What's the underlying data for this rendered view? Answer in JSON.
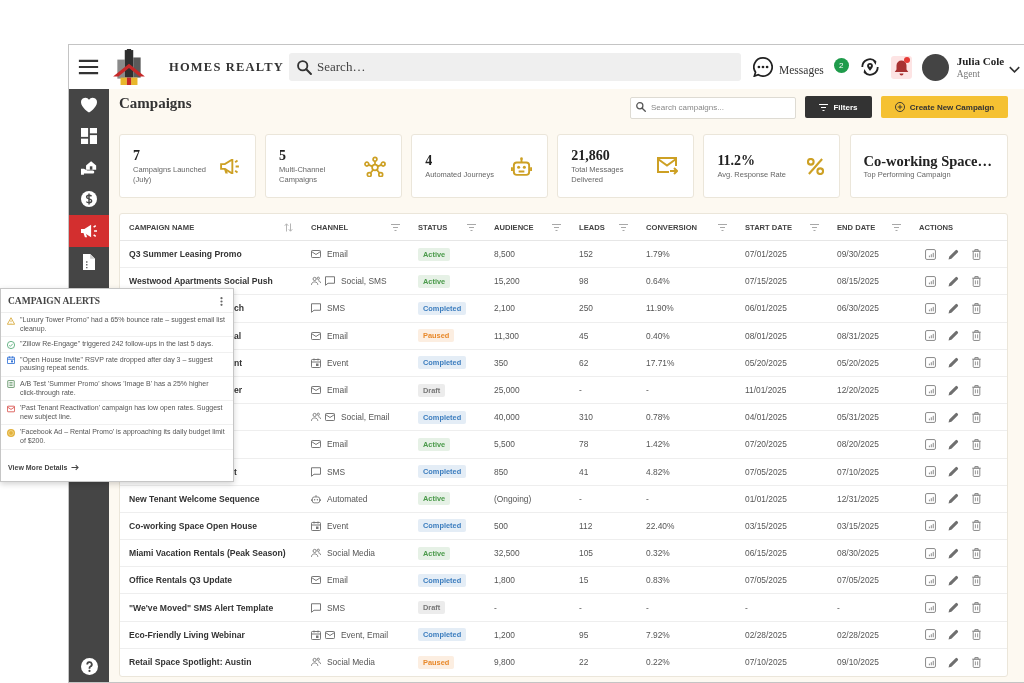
{
  "header": {
    "brand": "HOMES REALTY",
    "search": {
      "placeholder": "Search…"
    },
    "messages": {
      "label": "Messages",
      "count": "2"
    },
    "notifications": {
      "unread": true
    },
    "user": {
      "name": "Julia Cole",
      "role": "Agent"
    }
  },
  "sidebar": {
    "items": [
      {
        "kind": "favorites",
        "selected": false
      },
      {
        "kind": "dashboard",
        "selected": false
      },
      {
        "kind": "properties",
        "selected": false
      },
      {
        "kind": "finance",
        "selected": false
      },
      {
        "kind": "campaigns",
        "selected": true
      },
      {
        "kind": "documents",
        "selected": false
      }
    ]
  },
  "page": {
    "title": "Campaigns",
    "search": {
      "placeholder": "Search campaigns..."
    },
    "buttons": [
      {
        "kind": "filter",
        "label": "Filters"
      },
      {
        "kind": "create",
        "label": "Create New Campaign"
      }
    ]
  },
  "stats": [
    {
      "kind": "launched",
      "value": "7",
      "label": "Campaigns Launched (July)"
    },
    {
      "kind": "multichannel",
      "value": "5",
      "label": "Multi-Channel Campaigns"
    },
    {
      "kind": "automated",
      "value": "4",
      "label": "Automated Journeys"
    },
    {
      "kind": "delivered",
      "value": "21,860",
      "label": "Total Messages Delivered"
    },
    {
      "kind": "response",
      "value": "11.2%",
      "label": "Avg. Response Rate"
    },
    {
      "kind": "top",
      "value": "Co-working Space…",
      "label": "Top Performing Campaign"
    }
  ],
  "table": {
    "columns": [
      {
        "label": "CAMPAIGN NAME",
        "kind": "sort"
      },
      {
        "label": "CHANNEL",
        "kind": "filter"
      },
      {
        "label": "STATUS",
        "kind": "filter"
      },
      {
        "label": "AUDIENCE",
        "kind": "filter"
      },
      {
        "label": "LEADS",
        "kind": "filter"
      },
      {
        "label": "CONVERSION",
        "kind": "filter"
      },
      {
        "label": "START DATE",
        "kind": "filter"
      },
      {
        "label": "END DATE",
        "kind": "filter"
      },
      {
        "label": "ACTIONS",
        "kind": "plain"
      }
    ],
    "rows": [
      {
        "name": "Q3 Summer Leasing Promo",
        "name_partly_covered": false,
        "channel": {
          "label": "Email",
          "icons": [
            {
              "kind": "email"
            }
          ]
        },
        "status": {
          "label": "Active",
          "color": "#4a9a4a"
        },
        "audience": "8,500",
        "leads": "152",
        "conversion": "1.79%",
        "start_date": "07/01/2025",
        "end_date": "09/30/2025"
      },
      {
        "name": "Westwood Apartments Social Push",
        "name_partly_covered": false,
        "channel": {
          "label": "Social, SMS",
          "icons": [
            {
              "kind": "social"
            },
            {
              "kind": "sms"
            }
          ]
        },
        "status": {
          "label": "Active",
          "color": "#4a9a4a"
        },
        "audience": "15,200",
        "leads": "98",
        "conversion": "0.64%",
        "start_date": "07/15/2025",
        "end_date": "08/15/2025"
      },
      {
        "name": "ch",
        "name_partly_covered": true,
        "channel": {
          "label": "SMS",
          "icons": [
            {
              "kind": "sms"
            }
          ]
        },
        "status": {
          "label": "Completed",
          "color": "#3d7ebf"
        },
        "audience": "2,100",
        "leads": "250",
        "conversion": "11.90%",
        "start_date": "06/01/2025",
        "end_date": "06/30/2025"
      },
      {
        "name": "al",
        "name_partly_covered": true,
        "channel": {
          "label": "Email",
          "icons": [
            {
              "kind": "email"
            }
          ]
        },
        "status": {
          "label": "Paused",
          "color": "#e8892b"
        },
        "audience": "11,300",
        "leads": "45",
        "conversion": "0.40%",
        "start_date": "08/01/2025",
        "end_date": "08/31/2025"
      },
      {
        "name": "nt",
        "name_partly_covered": true,
        "channel": {
          "label": "Event",
          "icons": [
            {
              "kind": "event"
            }
          ]
        },
        "status": {
          "label": "Completed",
          "color": "#3d7ebf"
        },
        "audience": "350",
        "leads": "62",
        "conversion": "17.71%",
        "start_date": "05/20/2025",
        "end_date": "05/20/2025"
      },
      {
        "name": "er",
        "name_partly_covered": true,
        "channel": {
          "label": "Email",
          "icons": [
            {
              "kind": "email"
            }
          ]
        },
        "status": {
          "label": "Draft",
          "color": "#777777"
        },
        "audience": "25,000",
        "leads": "-",
        "conversion": "-",
        "start_date": "11/01/2025",
        "end_date": "12/20/2025"
      },
      {
        "channel": {
          "label": "Social, Email",
          "icons": [
            {
              "kind": "social"
            },
            {
              "kind": "email"
            }
          ]
        },
        "status": {
          "label": "Completed",
          "color": "#3d7ebf"
        },
        "audience": "40,000",
        "leads": "310",
        "conversion": "0.78%",
        "start_date": "04/01/2025",
        "end_date": "05/31/2025"
      },
      {
        "channel": {
          "label": "Email",
          "icons": [
            {
              "kind": "email"
            }
          ]
        },
        "status": {
          "label": "Active",
          "color": "#4a9a4a"
        },
        "audience": "5,500",
        "leads": "78",
        "conversion": "1.42%",
        "start_date": "07/20/2025",
        "end_date": "08/20/2025"
      },
      {
        "name": "t",
        "name_partly_covered": true,
        "channel": {
          "label": "SMS",
          "icons": [
            {
              "kind": "sms"
            }
          ]
        },
        "status": {
          "label": "Completed",
          "color": "#3d7ebf"
        },
        "audience": "850",
        "leads": "41",
        "conversion": "4.82%",
        "start_date": "07/05/2025",
        "end_date": "07/10/2025"
      },
      {
        "name": "New Tenant Welcome Sequence",
        "name_partly_covered": false,
        "channel": {
          "label": "Automated",
          "icons": [
            {
              "kind": "automated"
            }
          ]
        },
        "status": {
          "label": "Active",
          "color": "#4a9a4a"
        },
        "audience": "(Ongoing)",
        "leads": "-",
        "conversion": "-",
        "start_date": "01/01/2025",
        "end_date": "12/31/2025"
      },
      {
        "name": "Co-working Space Open House",
        "name_partly_covered": false,
        "channel": {
          "label": "Event",
          "icons": [
            {
              "kind": "event"
            }
          ]
        },
        "status": {
          "label": "Completed",
          "color": "#3d7ebf"
        },
        "audience": "500",
        "leads": "112",
        "conversion": "22.40%",
        "start_date": "03/15/2025",
        "end_date": "03/15/2025"
      },
      {
        "name": "Miami Vacation Rentals (Peak Season)",
        "name_partly_covered": false,
        "channel": {
          "label": "Social Media",
          "icons": [
            {
              "kind": "social"
            }
          ]
        },
        "status": {
          "label": "Active",
          "color": "#4a9a4a"
        },
        "audience": "32,500",
        "leads": "105",
        "conversion": "0.32%",
        "start_date": "06/15/2025",
        "end_date": "08/30/2025"
      },
      {
        "name": "Office Rentals Q3 Update",
        "name_partly_covered": false,
        "channel": {
          "label": "Email",
          "icons": [
            {
              "kind": "email"
            }
          ]
        },
        "status": {
          "label": "Completed",
          "color": "#3d7ebf"
        },
        "audience": "1,800",
        "leads": "15",
        "conversion": "0.83%",
        "start_date": "07/05/2025",
        "end_date": "07/05/2025"
      },
      {
        "name": "\"We've Moved\" SMS Alert Template",
        "name_partly_covered": false,
        "channel": {
          "label": "SMS",
          "icons": [
            {
              "kind": "sms"
            }
          ]
        },
        "status": {
          "label": "Draft",
          "color": "#777777"
        },
        "audience": "-",
        "leads": "-",
        "conversion": "-",
        "start_date": "-",
        "end_date": "-"
      },
      {
        "name": "Eco-Friendly Living Webinar",
        "name_partly_covered": false,
        "channel": {
          "label": "Event, Email",
          "icons": [
            {
              "kind": "event"
            },
            {
              "kind": "email"
            }
          ]
        },
        "status": {
          "label": "Completed",
          "color": "#3d7ebf"
        },
        "audience": "1,200",
        "leads": "95",
        "conversion": "7.92%",
        "start_date": "02/28/2025",
        "end_date": "02/28/2025"
      },
      {
        "name": "Retail Space Spotlight: Austin",
        "name_partly_covered": false,
        "channel": {
          "label": "Social Media",
          "icons": [
            {
              "kind": "social"
            }
          ]
        },
        "status": {
          "label": "Paused",
          "color": "#e8892b"
        },
        "audience": "9,800",
        "leads": "22",
        "conversion": "0.22%",
        "start_date": "07/10/2025",
        "end_date": "09/10/2025"
      }
    ]
  },
  "alerts": {
    "title": "CAMPAIGN ALERTS",
    "items": [
      {
        "kind": "warning",
        "text": "\"Luxury Tower Promo\" had a 65% bounce rate – suggest email list cleanup."
      },
      {
        "kind": "success",
        "text": "\"Zillow Re-Engage\" triggered 242 follow-ups in the last 5 days."
      },
      {
        "kind": "event",
        "text": "\"Open House Invite\" RSVP rate dropped after day 3 – suggest pausing repeat sends."
      },
      {
        "kind": "test",
        "text": "A/B Test 'Summer Promo' shows 'Image B' has a 25% higher click-through rate."
      },
      {
        "kind": "email",
        "text": "'Past Tenant Reactivation' campaign has low open rates. Suggest new subject line."
      },
      {
        "kind": "budget",
        "text": "'Facebook Ad – Rental Promo' is approaching its daily budget limit of $200."
      }
    ],
    "link": "View More Details"
  }
}
